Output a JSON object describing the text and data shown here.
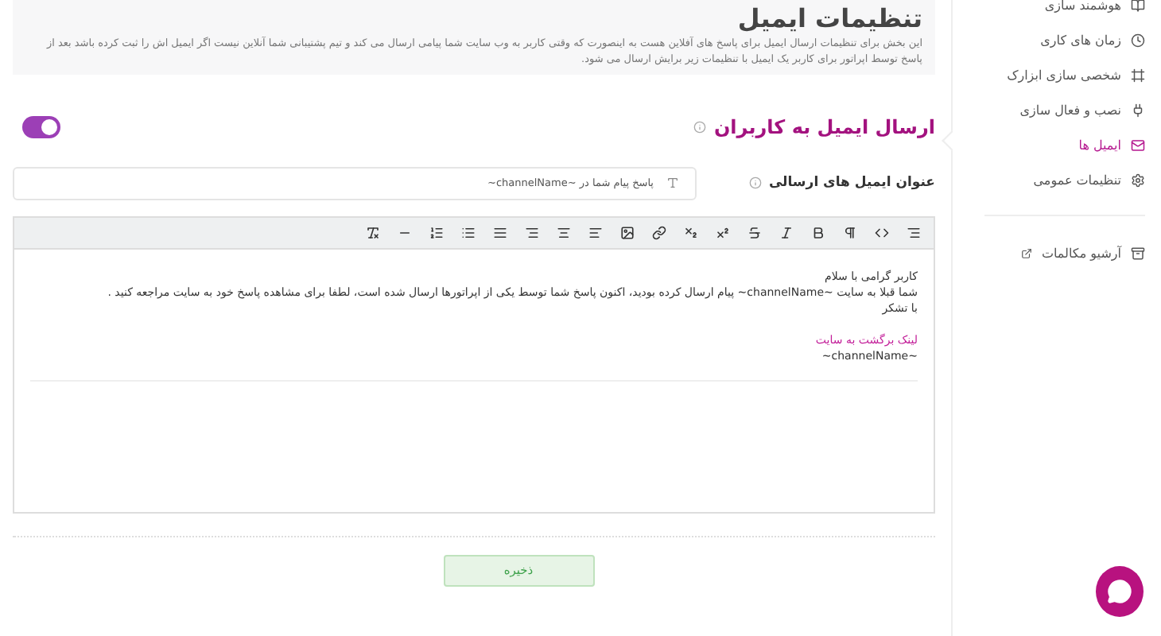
{
  "header": {
    "title": "تنظیمات ایمیل",
    "description": "این بخش برای تنظیمات ارسال ایمیل برای پاسخ های آفلاین هست به اینصورت که وقتی کاربر به وب سایت شما پیامی ارسال می کند و تیم پشتیبانی شما آنلاین نیست اگر ایمیل اش را ثبت کرده باشد بعد از پاسخ توسط اپراتور برای کاربر یک ایمیل با تنظیمات زیر برایش ارسال می شود."
  },
  "sidebar": {
    "items": [
      {
        "label": "هوشمند سازی",
        "selected": false
      },
      {
        "label": "زمان های کاری",
        "selected": false
      },
      {
        "label": "شخصی سازی ابزارک",
        "selected": false
      },
      {
        "label": "نصب و فعال سازی",
        "selected": false
      },
      {
        "label": "ایمیل ها",
        "selected": true
      },
      {
        "label": "تنظیمات عمومی",
        "selected": false
      }
    ],
    "archive": {
      "label": "آرشیو مکالمات"
    }
  },
  "section": {
    "title": "ارسال ایمیل به کاربران",
    "enabled": true
  },
  "subject": {
    "label": "عنوان ایمیل های ارسالی",
    "value": "پاسخ پیام شما در ~channelName~"
  },
  "toolbar": [
    {
      "kind": "align-menu"
    },
    {
      "kind": "code"
    },
    {
      "kind": "paragraph"
    },
    {
      "kind": "bold"
    },
    {
      "kind": "italic"
    },
    {
      "kind": "strike"
    },
    {
      "kind": "superscript"
    },
    {
      "kind": "subscript"
    },
    {
      "kind": "link"
    },
    {
      "kind": "image"
    },
    {
      "kind": "align-left"
    },
    {
      "kind": "align-center"
    },
    {
      "kind": "align-right"
    },
    {
      "kind": "justify"
    },
    {
      "kind": "bullet-list"
    },
    {
      "kind": "number-list"
    },
    {
      "kind": "rule"
    },
    {
      "kind": "clear-format"
    }
  ],
  "body": [
    {
      "kind": "text",
      "text": "کاربر گرامی با سلام"
    },
    {
      "kind": "text",
      "text": "شما قبلا به سایت ~channelName~ پیام ارسال کرده بودید، اکنون پاسخ شما توسط یکی از اپراتورها ارسال شده است، لطفا برای مشاهده پاسخ خود به سایت مراجعه کنید ."
    },
    {
      "kind": "text",
      "text": "با تشکر"
    },
    {
      "kind": "gap"
    },
    {
      "kind": "link",
      "text": "لینک برگشت به سایت"
    },
    {
      "kind": "text",
      "text": "~channelName~"
    }
  ],
  "save_button": "ذخیره"
}
